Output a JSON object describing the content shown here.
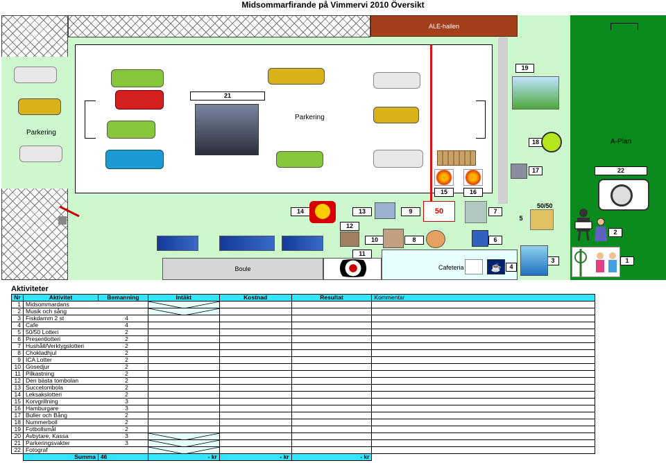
{
  "title": "Midsommarfirande på Vimmervi 2010 Översikt",
  "map": {
    "ale_hallen": "ALE-hallen",
    "parkering_left": "Parkering",
    "parkering_center": "Parkering",
    "a_plan": "A-Plan",
    "boule": "Boule",
    "cafeteria": "Cafeteria",
    "fifty_fifty": "50/50",
    "box_21": "21",
    "box_19": "19",
    "box_18": "18",
    "box_17": "17",
    "box_22": "22",
    "box_15": "15",
    "box_16": "16",
    "box_14": "14",
    "box_13": "13",
    "box_9": "9",
    "box_7": "7",
    "box_5": "5",
    "box_12": "12",
    "box_10": "10",
    "box_8": "8",
    "box_6": "6",
    "box_11": "11",
    "box_4": "4",
    "box_3": "3",
    "box_2": "2",
    "box_1": "1",
    "lotteri_sign": "50"
  },
  "colors": {
    "light_green": "#cdf7cd",
    "dark_green": "#0b8a1d",
    "ale_brown": "#a33f1a",
    "header_cyan": "#33e6ff",
    "cafeteria_blue": "#e6ffff"
  },
  "table": {
    "heading": "Aktiviteter",
    "columns": [
      "Nr",
      "Aktivitet",
      "Bemanning",
      "Intäkt",
      "Kostnad",
      "Resultat",
      "Kommentar"
    ],
    "rows": [
      {
        "nr": "1",
        "name": "Midsommardans",
        "staff": ""
      },
      {
        "nr": "2",
        "name": "Musik och sång",
        "staff": ""
      },
      {
        "nr": "3",
        "name": "Fiskdamm 2 st",
        "staff": "4"
      },
      {
        "nr": "4",
        "name": "Cafe",
        "staff": "4"
      },
      {
        "nr": "5",
        "name": "50/50 Lotteri",
        "staff": "2"
      },
      {
        "nr": "6",
        "name": "Presentlotteri",
        "staff": "2"
      },
      {
        "nr": "7",
        "name": "Hushåll/Verktygslotteri",
        "staff": "2"
      },
      {
        "nr": "8",
        "name": "Chokladhjul",
        "staff": "2"
      },
      {
        "nr": "9",
        "name": "ICA Lotter",
        "staff": "2"
      },
      {
        "nr": "10",
        "name": "Gosedjur",
        "staff": "2"
      },
      {
        "nr": "11",
        "name": "Pilkastning",
        "staff": "2"
      },
      {
        "nr": "12",
        "name": "Den bästa tombolan",
        "staff": "2"
      },
      {
        "nr": "13",
        "name": "Succetombola",
        "staff": "2"
      },
      {
        "nr": "14",
        "name": "Leksakslotteri",
        "staff": "2"
      },
      {
        "nr": "15",
        "name": "Korvgrillning",
        "staff": "3"
      },
      {
        "nr": "16",
        "name": "Hamburgare",
        "staff": "3"
      },
      {
        "nr": "17",
        "name": "Buller och Bång",
        "staff": "2"
      },
      {
        "nr": "18",
        "name": "Nummerboll",
        "staff": "2"
      },
      {
        "nr": "19",
        "name": "Fotbollsmål",
        "staff": "2"
      },
      {
        "nr": "20",
        "name": "Avbytare, Kassa",
        "staff": "3"
      },
      {
        "nr": "21",
        "name": "Parkeringsvakter",
        "staff": "3"
      },
      {
        "nr": "22",
        "name": "Fotograf",
        "staff": ""
      }
    ],
    "sum_label": "Summa",
    "sum_staff": "46",
    "sum_intakt": "-   kr",
    "sum_kostnad": "-   kr",
    "sum_resultat": "-   kr"
  }
}
